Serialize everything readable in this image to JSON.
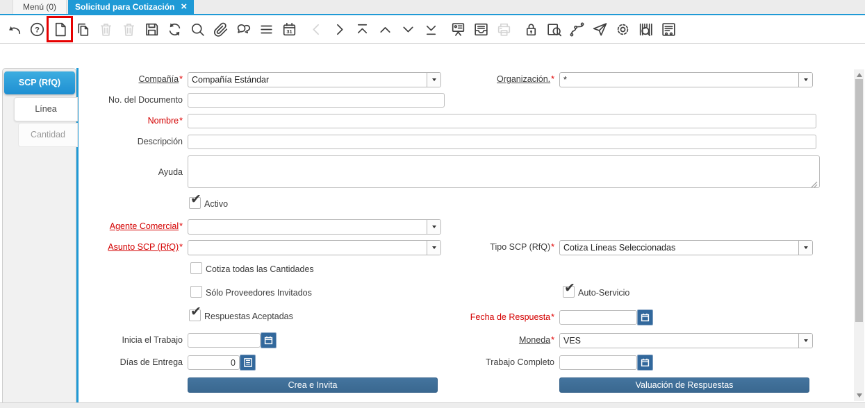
{
  "window": {
    "tabs": [
      {
        "label": "Menú (0)",
        "active": false
      },
      {
        "label": "Solicitud para Cotización",
        "active": true
      }
    ]
  },
  "glyphs": {
    "check": "✔",
    "close": "×"
  },
  "toolbar": {
    "highlight_color": "#e60000",
    "icons": [
      {
        "name": "undo",
        "enabled": true
      },
      {
        "name": "help",
        "enabled": true
      },
      {
        "name": "new-record",
        "enabled": true,
        "highlighted": true
      },
      {
        "name": "copy-record",
        "enabled": true
      },
      {
        "name": "delete-record",
        "enabled": false
      },
      {
        "name": "delete-selection",
        "enabled": false
      },
      {
        "name": "save",
        "enabled": true
      },
      {
        "name": "requery",
        "enabled": true
      },
      {
        "name": "find",
        "enabled": true
      },
      {
        "name": "attachment",
        "enabled": true
      },
      {
        "name": "chat",
        "enabled": true
      },
      {
        "name": "grid-toggle",
        "enabled": true
      },
      {
        "name": "calendar",
        "enabled": true
      },
      {
        "name": "previous-record",
        "enabled": false
      },
      {
        "name": "next-record",
        "enabled": true
      },
      {
        "name": "first-record",
        "enabled": true
      },
      {
        "name": "parent-record",
        "enabled": true
      },
      {
        "name": "detail-record",
        "enabled": true
      },
      {
        "name": "last-record",
        "enabled": true
      },
      {
        "name": "form",
        "enabled": true
      },
      {
        "name": "archive",
        "enabled": true
      },
      {
        "name": "print",
        "enabled": false
      },
      {
        "name": "private-lock",
        "enabled": true
      },
      {
        "name": "zoom-across",
        "enabled": true
      },
      {
        "name": "workflow",
        "enabled": true
      },
      {
        "name": "send-mail",
        "enabled": true
      },
      {
        "name": "preferences",
        "enabled": true
      },
      {
        "name": "product-info",
        "enabled": true
      },
      {
        "name": "report",
        "enabled": true
      }
    ]
  },
  "sidebar": {
    "tabs": [
      {
        "label": "SCP (RfQ)",
        "state": "active"
      },
      {
        "label": "Línea",
        "state": "normal"
      },
      {
        "label": "Cantidad",
        "state": "dimmed"
      }
    ]
  },
  "form": {
    "fields": {
      "compania": {
        "label": "Compañía",
        "required": "*",
        "value": "Compañía Estándar"
      },
      "organizacion": {
        "label": "Organización.",
        "required": "*",
        "value": "*"
      },
      "no_documento": {
        "label": "No. del Documento",
        "value": ""
      },
      "nombre": {
        "label": "Nombre",
        "required": "*",
        "value": ""
      },
      "descripcion": {
        "label": "Descripción",
        "value": ""
      },
      "ayuda": {
        "label": "Ayuda",
        "value": ""
      },
      "activo": {
        "label": "Activo",
        "checked": true
      },
      "agente_comercial": {
        "label": "Agente Comercial",
        "required": "*",
        "value": ""
      },
      "asunto_scp": {
        "label": "Asunto SCP (RfQ)",
        "required": "*",
        "value": ""
      },
      "tipo_scp": {
        "label": "Tipo SCP (RfQ)",
        "required": "*",
        "value": "Cotiza Líneas Seleccionadas"
      },
      "cotiza_todas": {
        "label": "Cotiza todas las Cantidades",
        "checked": false
      },
      "solo_proveedores": {
        "label": "Sólo Proveedores Invitados",
        "checked": false
      },
      "auto_servicio": {
        "label": "Auto-Servicio",
        "checked": true
      },
      "respuestas_aceptadas": {
        "label": "Respuestas Aceptadas",
        "checked": true
      },
      "fecha_respuesta": {
        "label": "Fecha de Respuesta",
        "required": "*",
        "value": ""
      },
      "inicia_trabajo": {
        "label": "Inicia el Trabajo",
        "value": ""
      },
      "moneda": {
        "label": "Moneda",
        "required": "*",
        "value": "VES"
      },
      "dias_entrega": {
        "label": "Días de Entrega",
        "value": "0"
      },
      "trabajo_completo": {
        "label": "Trabajo Completo",
        "value": ""
      }
    },
    "buttons": {
      "crea_invita": "Crea e Invita",
      "valuacion": "Valuación de Respuestas"
    }
  },
  "colors": {
    "accent_blue": "#1f9ad6",
    "button_blue": "#3a6c9b",
    "required_red": "#d40000"
  }
}
